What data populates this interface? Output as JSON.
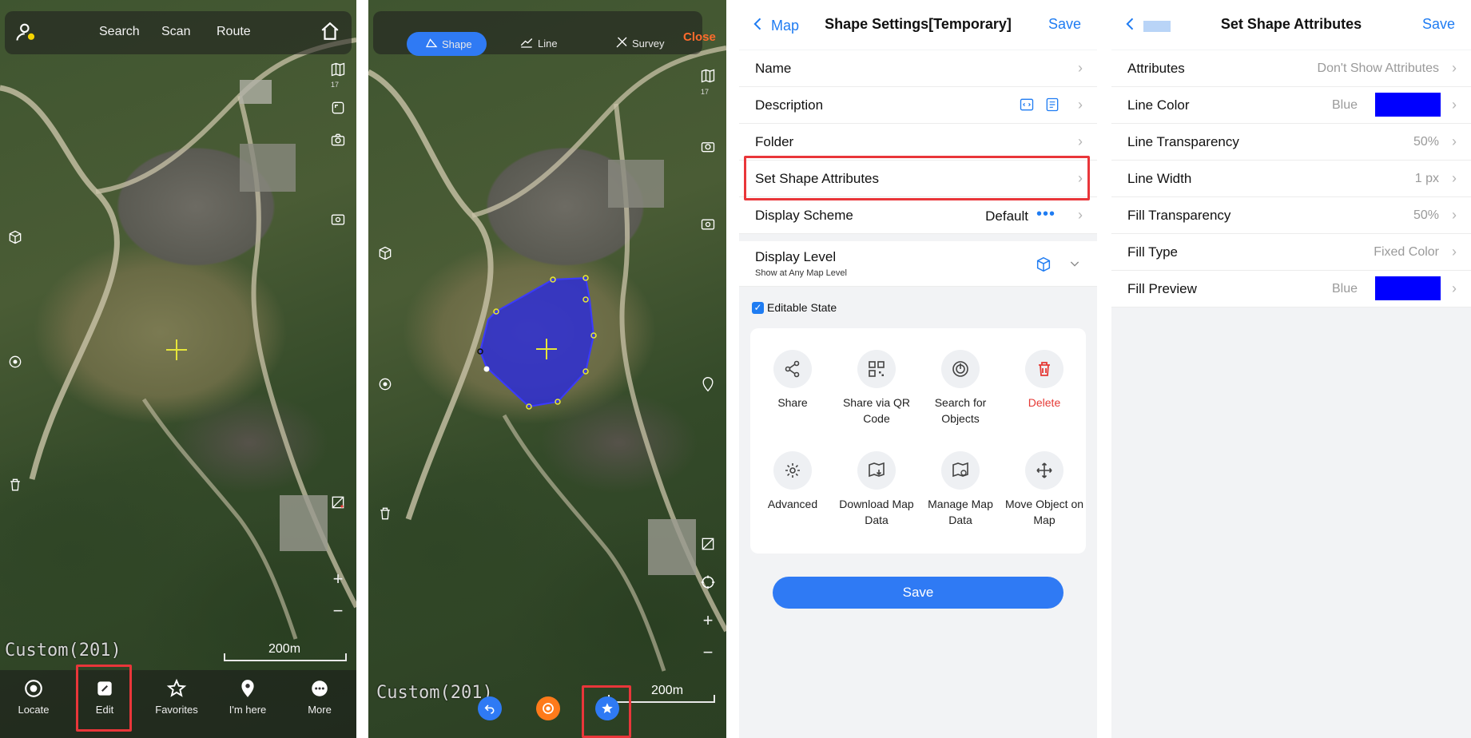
{
  "panel1": {
    "topbar": {
      "search": "Search",
      "scan": "Scan",
      "route": "Route"
    },
    "scale": "200m",
    "watermark": "Custom(201)",
    "nav": [
      {
        "label": "Locate",
        "icon": "locate-icon"
      },
      {
        "label": "Edit",
        "icon": "edit-icon"
      },
      {
        "label": "Favorites",
        "icon": "star-icon"
      },
      {
        "label": "I'm here",
        "icon": "pin-icon"
      },
      {
        "label": "More",
        "icon": "more-icon"
      }
    ],
    "zoom_badge": "17"
  },
  "panel2": {
    "modes": {
      "shape": "Shape",
      "line": "Line",
      "survey": "Survey"
    },
    "close": "Close",
    "scale": "200m",
    "watermark": "Custom(201)",
    "zoom_badge": "17"
  },
  "panel3": {
    "header": {
      "back": "Map",
      "title": "Shape Settings[Temporary]",
      "save": "Save"
    },
    "rows": {
      "name": "Name",
      "description": "Description",
      "folder": "Folder",
      "set_shape_attributes": "Set Shape Attributes",
      "display_scheme": "Display Scheme",
      "display_scheme_value": "Default",
      "display_level": "Display Level",
      "display_level_sub": "Show at Any Map Level"
    },
    "editable_state": "Editable State",
    "actions": [
      {
        "label": "Share",
        "icon": "share-icon"
      },
      {
        "label": "Share via QR Code",
        "icon": "qr-code-icon"
      },
      {
        "label": "Search for Objects",
        "icon": "radar-icon"
      },
      {
        "label": "Delete",
        "icon": "trash-icon"
      },
      {
        "label": "Advanced",
        "icon": "advanced-icon"
      },
      {
        "label": "Download Map Data",
        "icon": "download-map-icon"
      },
      {
        "label": "Manage Map Data",
        "icon": "manage-map-icon"
      },
      {
        "label": "Move Object on Map",
        "icon": "move-icon"
      }
    ],
    "save_button": "Save"
  },
  "panel4": {
    "header": {
      "title": "Set Shape Attributes",
      "save": "Save"
    },
    "rows": [
      {
        "label": "Attributes",
        "value": "Don't Show Attributes"
      },
      {
        "label": "Line Color",
        "value": "Blue"
      },
      {
        "label": "Line Transparency",
        "value": "50%"
      },
      {
        "label": "Line Width",
        "value": "1 px"
      },
      {
        "label": "Fill Transparency",
        "value": "50%"
      },
      {
        "label": "Fill Type",
        "value": "Fixed Color"
      },
      {
        "label": "Fill Preview",
        "value": "Blue"
      }
    ]
  },
  "colors": {
    "accent": "#1f7cf2",
    "highlight": "#e9363a",
    "shape_fill": "#2b2bd9",
    "swatch": "#0000ff",
    "delete": "#e53935",
    "close": "#ff6b2c"
  }
}
